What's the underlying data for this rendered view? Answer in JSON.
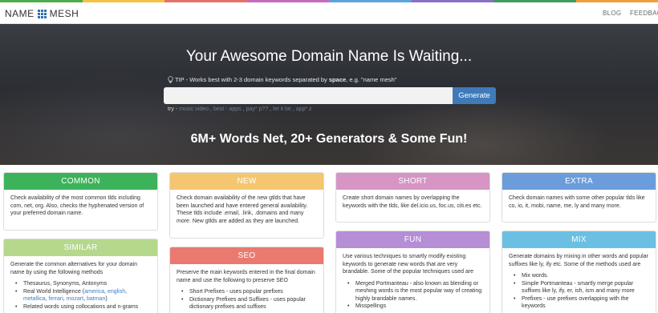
{
  "brand": {
    "name_left": "NAME",
    "name_right": "MESH"
  },
  "nav": {
    "blog": "BLOG",
    "feedback": "FEEDBACK"
  },
  "rainbow_colors": [
    "#4cae4c",
    "#f5c242",
    "#e5716c",
    "#c46bbf",
    "#5ba4dc",
    "#8a6fc6",
    "#3c9c63",
    "#f0a03a"
  ],
  "hero": {
    "title": "Your Awesome Domain Name Is Waiting...",
    "tip_prefix": "TIP - Works best with 2-3 domain keywords separated by ",
    "tip_bold": "space",
    "tip_suffix": ", e.g. \"name mesh\"",
    "search_value": "",
    "generate_label": "Generate",
    "try_label": "try -",
    "try_links": [
      "music video",
      "best - apps",
      "pay* p??",
      "let it be",
      "app* z"
    ],
    "subtitle": "6M+ Words Net, 20+ Generators & Some Fun!"
  },
  "colors": {
    "common": "#3cb35a",
    "new": "#f5c670",
    "short": "#d695c4",
    "extra": "#6b9ddc",
    "similar": "#b5d88c",
    "seo": "#ea7a70",
    "fun": "#b58ed6",
    "mix": "#6bbfe3",
    "generate_button": "#3f7ab9"
  },
  "cards": {
    "common": {
      "title": "COMMON",
      "text": "Check availability of the most common tlds including com, net, org. Also, checks the hyphenated version of your preferred domain name."
    },
    "new": {
      "title": "NEW",
      "text": "Check domain availability of the new gtlds that have been launched and have entered general availability. These tlds include .email, .link, .domains and many more. New gtlds are added as they are launched."
    },
    "short": {
      "title": "SHORT",
      "text": "Create short domain names by overlapping the keywords with the tlds, like del.icio.us, foc.us, citi.es etc."
    },
    "extra": {
      "title": "EXTRA",
      "text": "Check domain names with some other popular tlds like co, io, it, mobi, name, me, ly and many more."
    },
    "similar": {
      "title": "SIMILAR",
      "text": "Generate the common alternatives for your domain name by using the following methods",
      "item1": "Thesaurus, Synonyms, Antonyms",
      "item2_prefix": "Real World Intelligence (",
      "item2_links": [
        "america",
        "english",
        "metallica",
        "ferrari",
        "mozart",
        "batman"
      ],
      "item2_suffix": ")",
      "item3": "Related words using collocations and n-grams"
    },
    "seo": {
      "title": "SEO",
      "text": "Preserve the main keywords entered in the final domain name and use the following to preserve SEO",
      "item1": "Short Prefixes - uses popular prefixes",
      "item2": "Dictionary Prefixes and Suffixes - uses popular dictionary prefixes and suffixes"
    },
    "fun": {
      "title": "FUN",
      "text": "Use various techniques to smartly modify existing keywords to generate new words that are very brandable. Some of the popular techniques used are",
      "item1": "Merged Portmanteau - also known as blending or meshing words is the most popular way of creating highly brandable names.",
      "item2": "Misspellings"
    },
    "mix": {
      "title": "MIX",
      "text": "Generate domains by mixing in other words and popular suffixes like ly, ify etc. Some of the methods used are",
      "item1": "Mix words.",
      "item2": "Simple Portmanteau - smartly merge popular suffixes like ly, ify, er, ish, ism and many more",
      "item3": "Prefixes - use prefixes overlapping with the keywords"
    }
  }
}
